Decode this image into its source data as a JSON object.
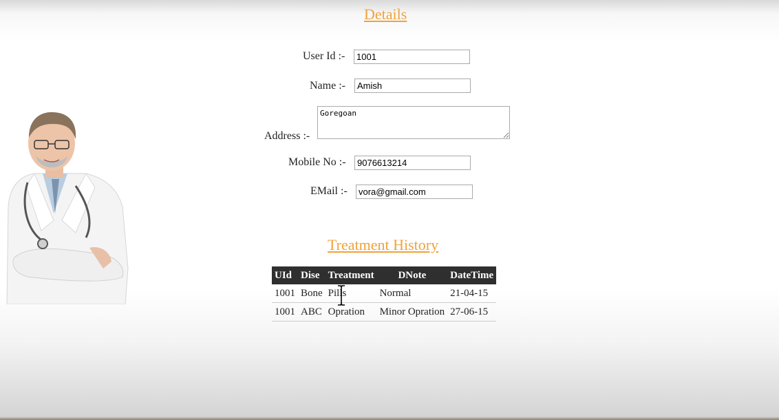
{
  "details": {
    "title": "Details",
    "fields": {
      "user_id": {
        "label": "User Id :-",
        "value": "1001"
      },
      "name": {
        "label": "Name :-",
        "value": "Amish"
      },
      "address": {
        "label": "Address :-",
        "value": "Goregoan"
      },
      "mobile": {
        "label": "Mobile No :-",
        "value": "9076613214"
      },
      "email": {
        "label": "EMail :-",
        "value": "vora@gmail.com"
      }
    }
  },
  "history": {
    "title": "Treatment History",
    "columns": [
      "UId",
      "Dise",
      "Treatment",
      "DNote",
      "DateTime"
    ],
    "rows": [
      [
        "1001",
        "Bone",
        "Pills",
        "Normal",
        "21-04-15"
      ],
      [
        "1001",
        "ABC",
        "Opration",
        "Minor Opration",
        "27-06-15"
      ]
    ]
  },
  "colors": {
    "heading": "#f0a23a",
    "table_header_bg": "#2f2f2f"
  },
  "icons": {
    "doctor": "doctor-illustration",
    "cursor": "text-cursor-icon"
  }
}
